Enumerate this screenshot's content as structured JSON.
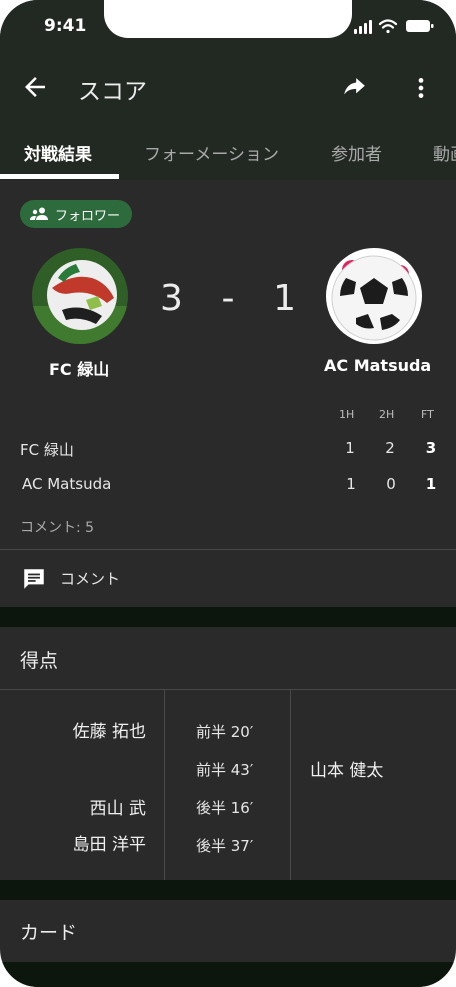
{
  "status": {
    "time": "9:41"
  },
  "appbar": {
    "title": "スコア",
    "back_icon": "arrow-left-icon",
    "share_icon": "share-icon",
    "more_icon": "more-vert-icon"
  },
  "tabs": [
    {
      "label": "対戦結果",
      "active": true
    },
    {
      "label": "フォーメーション",
      "active": false
    },
    {
      "label": "参加者",
      "active": false
    },
    {
      "label": "動画",
      "active": false
    }
  ],
  "follow_chip": {
    "label": "フォロワー",
    "icon": "people-icon"
  },
  "match": {
    "home": {
      "name": "FC 緑山",
      "logo": "soccer-ball-green-logo"
    },
    "away": {
      "name": "AC Matsuda",
      "logo": "soccer-ball-black-white-logo"
    },
    "home_score": "3",
    "separator": "-",
    "away_score": "1"
  },
  "breakdown": {
    "headers": [
      "1H",
      "2H",
      "FT"
    ],
    "rows": [
      {
        "team": "FC 緑山",
        "values": [
          "1",
          "2",
          "3"
        ]
      },
      {
        "team": "AC Matsuda",
        "values": [
          "1",
          "0",
          "1"
        ]
      }
    ]
  },
  "comments": {
    "count_text": "コメント: 5",
    "button_label": "コメント",
    "icon": "comment-icon"
  },
  "goals": {
    "title": "得点",
    "home_scorers": [
      "佐藤 拓也",
      "西山 武",
      "島田 洋平"
    ],
    "minutes": [
      "前半 20′",
      "前半 43′",
      "後半 16′",
      "後半 37′"
    ],
    "away_scorers": [
      "山本 健太"
    ]
  },
  "cards": {
    "title": "カード"
  },
  "colors": {
    "accent_green": "#2e6b3c",
    "background": "#2a2a2a",
    "topbar": "#222822"
  }
}
